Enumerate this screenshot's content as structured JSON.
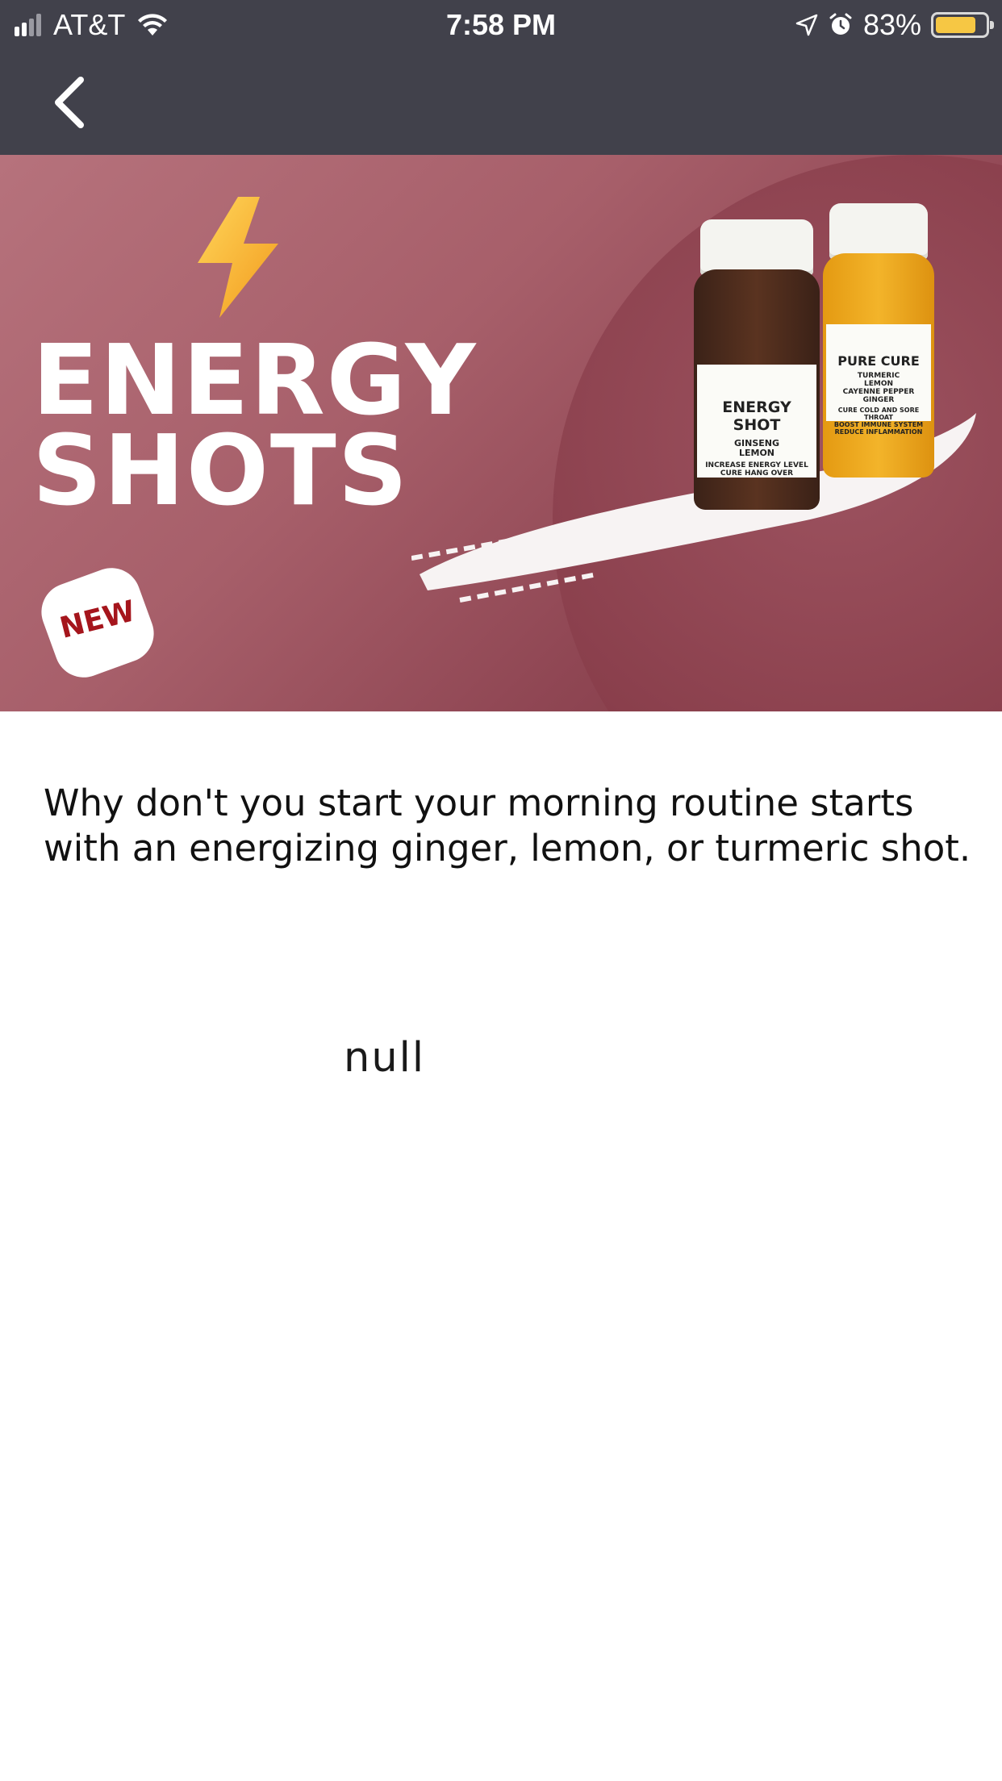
{
  "status_bar": {
    "carrier": "AT&T",
    "time": "7:58 PM",
    "battery_percent": "83%",
    "battery_level": 0.83,
    "icons": [
      "signal-icon",
      "wifi-icon",
      "location-icon",
      "alarm-icon",
      "battery-icon"
    ]
  },
  "nav": {
    "back_icon": "chevron-left-icon"
  },
  "hero": {
    "title_line1": "ENERGY",
    "title_line2": "SHOTS",
    "badge": "NEW",
    "bottle_left": {
      "name": "ENERGY SHOT",
      "ingredients": [
        "GINSENG",
        "LEMON"
      ],
      "benefits": [
        "INCREASE ENERGY LEVEL",
        "CURE HANG OVER"
      ]
    },
    "bottle_right": {
      "name": "PURE CURE",
      "ingredients": [
        "TURMERIC",
        "LEMON",
        "CAYENNE PEPPER",
        "GINGER"
      ],
      "benefits": [
        "CURE COLD AND SORE THROAT",
        "BOOST IMMUNE SYSTEM",
        "REDUCE INFLAMMATION"
      ]
    },
    "colors": {
      "background": "#a75f6a",
      "bolt": "#f6b73c",
      "badge_text": "#a5151c"
    }
  },
  "content": {
    "description": "Why don't you start your morning routine starts with an energizing ginger, lemon, or turmeric shot.",
    "extra_text": "null"
  }
}
